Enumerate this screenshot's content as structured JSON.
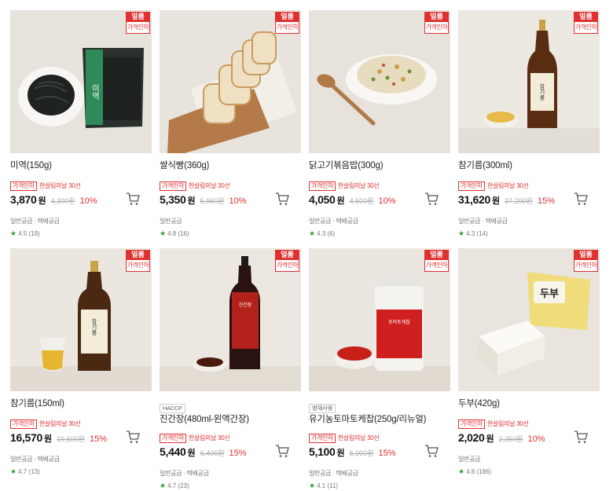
{
  "products": [
    {
      "name": "미역(150g)",
      "badge_top": "얼룸",
      "badge_bottom": "가격인하",
      "tag": "가격인하",
      "tag_note": "한살림의날 30선",
      "price": "3,870",
      "won": "원",
      "original": "4,300원",
      "discount": "10%",
      "delivery": "일반공급 · 택배공급",
      "rating": "4.5 (19)",
      "pre_tag": ""
    },
    {
      "name": "쌀식빵(360g)",
      "badge_top": "얼룸",
      "badge_bottom": "가격인하",
      "tag": "가격인하",
      "tag_note": "한살림의날 30선",
      "price": "5,350",
      "won": "원",
      "original": "5,950원",
      "discount": "10%",
      "delivery": "일반공급",
      "rating": "4.8 (16)",
      "pre_tag": ""
    },
    {
      "name": "닭고기볶음밥(300g)",
      "badge_top": "얼룸",
      "badge_bottom": "가격인하",
      "tag": "가격인하",
      "tag_note": "한살림의날 30선",
      "price": "4,050",
      "won": "원",
      "original": "4,500원",
      "discount": "10%",
      "delivery": "일반공급 · 택배공급",
      "rating": "4.3 (6)",
      "pre_tag": ""
    },
    {
      "name": "참기름(300ml)",
      "badge_top": "얼룸",
      "badge_bottom": "가격인하",
      "tag": "가격인하",
      "tag_note": "한살림의날 30선",
      "price": "31,620",
      "won": "원",
      "original": "37,200원",
      "discount": "15%",
      "delivery": "일반공급 · 택배공급",
      "rating": "4.3 (14)",
      "pre_tag": ""
    },
    {
      "name": "참기름(150ml)",
      "badge_top": "얼룸",
      "badge_bottom": "가격인하",
      "tag": "가격인하",
      "tag_note": "한살림의날 30선",
      "price": "16,570",
      "won": "원",
      "original": "19,500원",
      "discount": "15%",
      "delivery": "일반공급 · 택배공급",
      "rating": "4.7 (13)",
      "pre_tag": ""
    },
    {
      "name": "진간장(480ml-왼액간장)",
      "badge_top": "얼룸",
      "badge_bottom": "가격인하",
      "tag": "가격인하",
      "tag_note": "한살림의날 30선",
      "price": "5,440",
      "won": "원",
      "original": "6,400원",
      "discount": "15%",
      "delivery": "일반공급 · 택배공급",
      "rating": "4.7 (23)",
      "pre_tag": "HACCP"
    },
    {
      "name": "유기농토마토케찹(250g/리뉴얼)",
      "badge_top": "얼룸",
      "badge_bottom": "가격인하",
      "tag": "가격인하",
      "tag_note": "한살림의날 30선",
      "price": "5,100",
      "won": "원",
      "original": "6,000원",
      "discount": "15%",
      "delivery": "일반공급 · 택배공급",
      "rating": "4.1 (11)",
      "pre_tag": "병재사용"
    },
    {
      "name": "두부(420g)",
      "badge_top": "얼룸",
      "badge_bottom": "가격인하",
      "tag": "가격인하",
      "tag_note": "한살림의날 30선",
      "price": "2,020",
      "won": "원",
      "original": "2,250원",
      "discount": "10%",
      "delivery": "일반공급",
      "rating": "4.8 (186)",
      "pre_tag": ""
    }
  ],
  "image_labels": {
    "seaweed_pack": "미역",
    "oil_bottle": "참기름",
    "soy_bottle": "진간장",
    "ketchup_jar": "토마토케찹",
    "tofu_pack": "두부"
  },
  "icons": {
    "cart": "cart-icon",
    "star": "star-icon"
  },
  "colors": {
    "accent_red": "#e03131",
    "star_green": "#2f9e44"
  }
}
